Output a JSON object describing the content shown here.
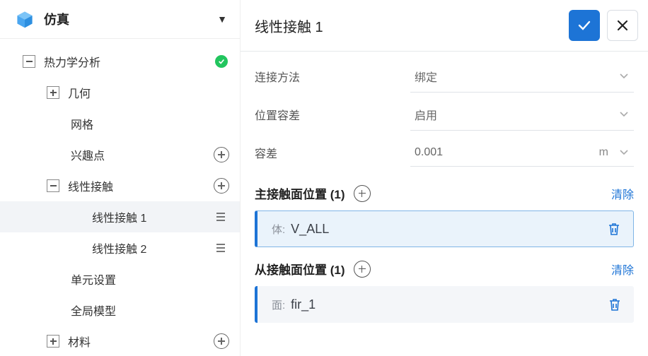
{
  "sidebar": {
    "title": "仿真",
    "root": {
      "label": "热力学分析",
      "status": "ok"
    },
    "items": {
      "geometry": "几何",
      "mesh": "网格",
      "poi": "兴趣点",
      "linear_contact": "线性接触",
      "linear_contact_1": "线性接触 1",
      "linear_contact_2": "线性接触 2",
      "unit_settings": "单元设置",
      "global_model": "全局模型",
      "material": "材料"
    }
  },
  "panel": {
    "title": "线性接触 1",
    "form": {
      "method_label": "连接方法",
      "method_value": "绑定",
      "pos_tol_label": "位置容差",
      "pos_tol_value": "启用",
      "tol_label": "容差",
      "tol_value": "0.001",
      "tol_unit": "m"
    },
    "master": {
      "title": "主接触面位置 (1)",
      "clear": "清除",
      "item_prefix": "体:",
      "item_value": "V_ALL"
    },
    "slave": {
      "title": "从接触面位置 (1)",
      "clear": "清除",
      "item_prefix": "面:",
      "item_value": "fir_1"
    }
  }
}
